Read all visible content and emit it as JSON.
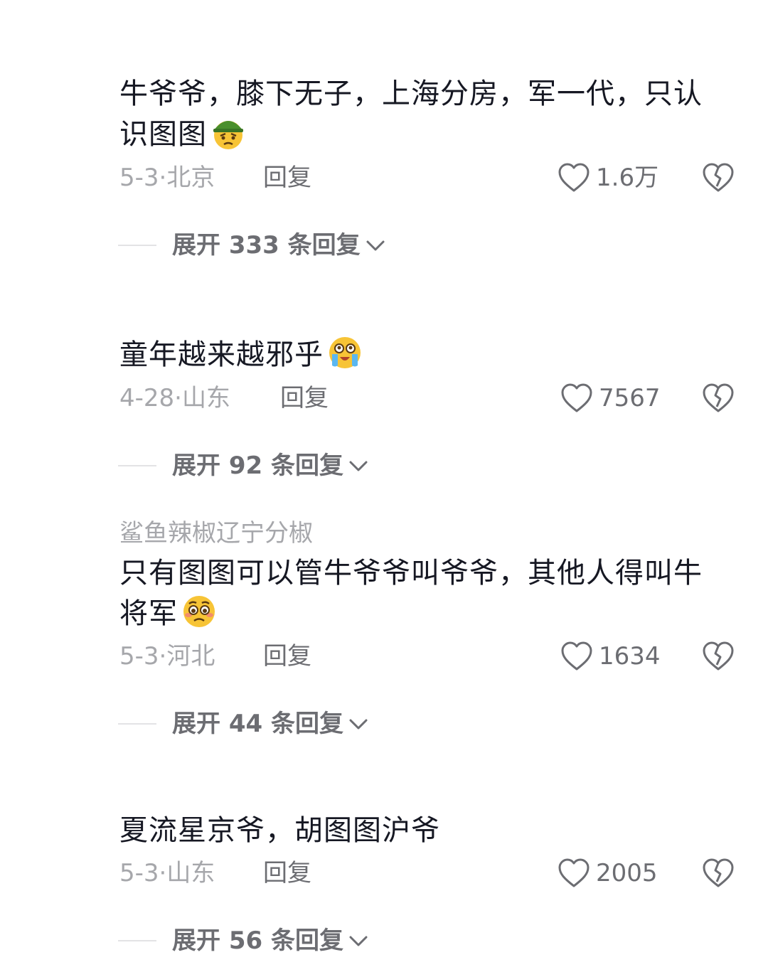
{
  "comments": [
    {
      "username": "",
      "text": "牛爷爷，膝下无子，上海分房，军一代，只认识图图",
      "emoji": "soldier-helmet-face-emoji",
      "date": "5-3",
      "location": "北京",
      "reply_label": "回复",
      "likes": "1.6万",
      "expand_label": "展开 333 条回复"
    },
    {
      "username": "",
      "text": "童年越来越邪乎",
      "emoji": "crying-face-emoji",
      "date": "4-28",
      "location": "山东",
      "reply_label": "回复",
      "likes": "7567",
      "expand_label": "展开 92 条回复"
    },
    {
      "username": "鲨鱼辣椒辽宁分椒",
      "text": "只有图图可以管牛爷爷叫爷爷，其他人得叫牛将军",
      "emoji": "pleading-face-emoji",
      "date": "5-3",
      "location": "河北",
      "reply_label": "回复",
      "likes": "1634",
      "expand_label": "展开 44 条回复"
    },
    {
      "username": "",
      "text": "夏流星京爷，胡图图沪爷",
      "emoji": "",
      "date": "5-3",
      "location": "山东",
      "reply_label": "回复",
      "likes": "2005",
      "expand_label": "展开 56 条回复"
    }
  ],
  "separator": "·",
  "icons": {
    "like": "heart-outline-icon",
    "dislike": "broken-heart-icon",
    "expand": "chevron-down-icon"
  },
  "colors": {
    "text_primary": "#161823",
    "text_secondary": "#a6a7ab",
    "text_action": "#6c6d72",
    "divider": "#e3e3e5"
  }
}
